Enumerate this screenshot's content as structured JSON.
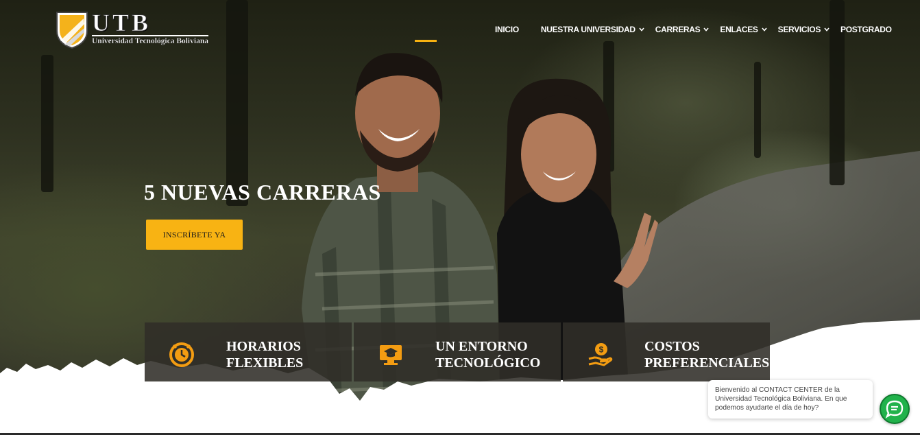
{
  "brand": {
    "logo_text": "UTB",
    "logo_subtitle": "Universidad Tecnológica Boliviana",
    "accent_color": "#f8b313"
  },
  "nav": {
    "items": [
      {
        "label": "INICIO",
        "has_dropdown": false,
        "active": true
      },
      {
        "label": "NUESTRA UNIVERSIDAD",
        "has_dropdown": true
      },
      {
        "label": "CARRERAS",
        "has_dropdown": true
      },
      {
        "label": "ENLACES",
        "has_dropdown": true
      },
      {
        "label": "SERVICIOS",
        "has_dropdown": true
      },
      {
        "label": "POSTGRADO",
        "has_dropdown": false
      }
    ]
  },
  "hero": {
    "title": "5 NUEVAS CARRERAS",
    "cta_label": "INSCRÍBETE YA"
  },
  "features": [
    {
      "label": "HORARIOS\nFLEXIBLES",
      "icon": "clock-icon"
    },
    {
      "label": "UN ENTORNO\nTECNOLÓGICO",
      "icon": "graduation-monitor-icon"
    },
    {
      "label": "COSTOS\nPREFERENCIALES",
      "icon": "money-hand-icon"
    }
  ],
  "chat": {
    "message": "Bienvenido al CONTACT CENTER de la Universidad Tecnológica Boliviana. En que podemos ayudarte el día de hoy?",
    "button_icon": "chat-icon",
    "button_color": "#21b24b"
  }
}
